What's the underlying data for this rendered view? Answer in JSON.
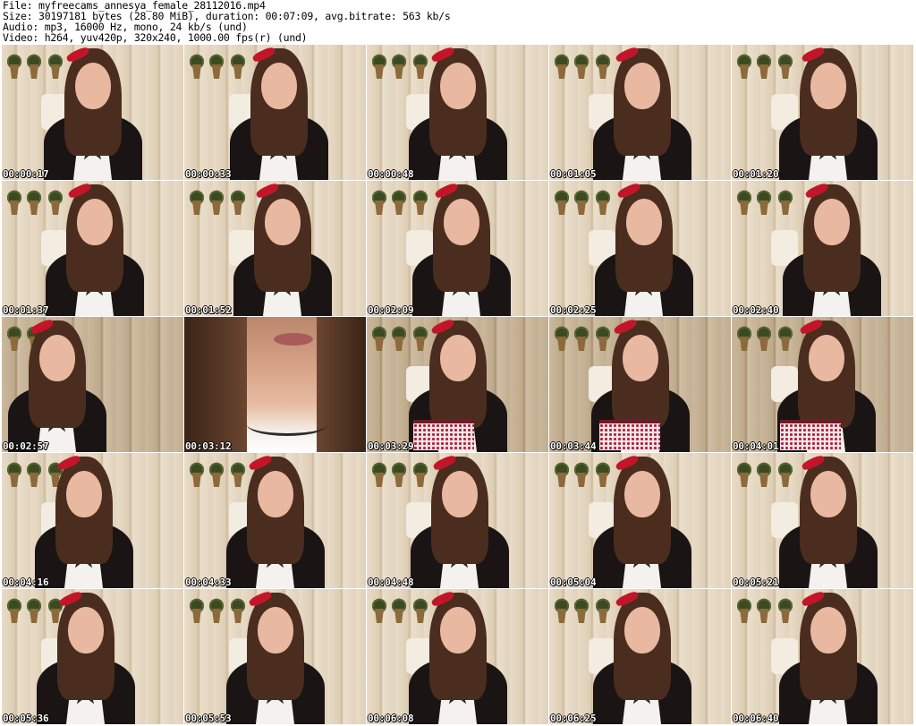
{
  "header": {
    "file_line": "File: myfreecams_annesya_female_28112016.mp4",
    "size_line": "Size: 30197181 bytes (28.80 MiB), duration: 00:07:09, avg.bitrate: 563 kb/s",
    "audio_line": "Audio: mp3, 16000 Hz, mono, 24 kb/s (und)",
    "video_line": "Video: h264, yuv420p, 320x240, 1000.00 fps(r) (und)"
  },
  "thumbnails": [
    {
      "timestamp": "00:00:17"
    },
    {
      "timestamp": "00:00:33"
    },
    {
      "timestamp": "00:00:48"
    },
    {
      "timestamp": "00:01:05"
    },
    {
      "timestamp": "00:01:20"
    },
    {
      "timestamp": "00:01:37"
    },
    {
      "timestamp": "00:01:52"
    },
    {
      "timestamp": "00:02:09"
    },
    {
      "timestamp": "00:02:25"
    },
    {
      "timestamp": "00:02:40"
    },
    {
      "timestamp": "00:02:57"
    },
    {
      "timestamp": "00:03:12"
    },
    {
      "timestamp": "00:03:29"
    },
    {
      "timestamp": "00:03:44"
    },
    {
      "timestamp": "00:04:01"
    },
    {
      "timestamp": "00:04:16"
    },
    {
      "timestamp": "00:04:33"
    },
    {
      "timestamp": "00:04:48"
    },
    {
      "timestamp": "00:05:04"
    },
    {
      "timestamp": "00:05:21"
    },
    {
      "timestamp": "00:05:36"
    },
    {
      "timestamp": "00:05:53"
    },
    {
      "timestamp": "00:06:08"
    },
    {
      "timestamp": "00:06:25"
    },
    {
      "timestamp": "00:06:40"
    }
  ]
}
